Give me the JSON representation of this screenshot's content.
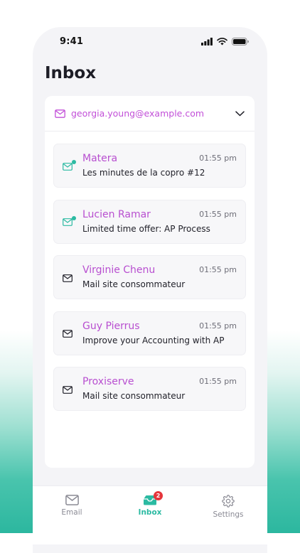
{
  "status_bar": {
    "time": "9:41"
  },
  "header": {
    "title": "Inbox"
  },
  "account": {
    "email": "georgia.young@example.com"
  },
  "mails": [
    {
      "sender": "Matera",
      "subject": "Les minutes de la copro #12",
      "time": "01:55 pm",
      "unread": true
    },
    {
      "sender": "Lucien Ramar",
      "subject": "Limited time offer: AP Process",
      "time": "01:55 pm",
      "unread": true
    },
    {
      "sender": "Virginie Chenu",
      "subject": "Mail site consommateur",
      "time": "01:55 pm",
      "unread": false
    },
    {
      "sender": "Guy Pierrus",
      "subject": "Improve your Accounting with AP",
      "time": "01:55 pm",
      "unread": false
    },
    {
      "sender": "Proxiserve",
      "subject": "Mail site consommateur",
      "time": "01:55 pm",
      "unread": false
    }
  ],
  "tabs": [
    {
      "label": "Email",
      "icon": "envelope-icon",
      "active": false
    },
    {
      "label": "Inbox",
      "icon": "inbox-tray-icon",
      "active": true,
      "badge": "2"
    },
    {
      "label": "Settings",
      "icon": "gear-icon",
      "active": false
    }
  ],
  "colors": {
    "accent": "#2bbaa2",
    "sender": "#b84fd0",
    "badge": "#e5353b"
  }
}
